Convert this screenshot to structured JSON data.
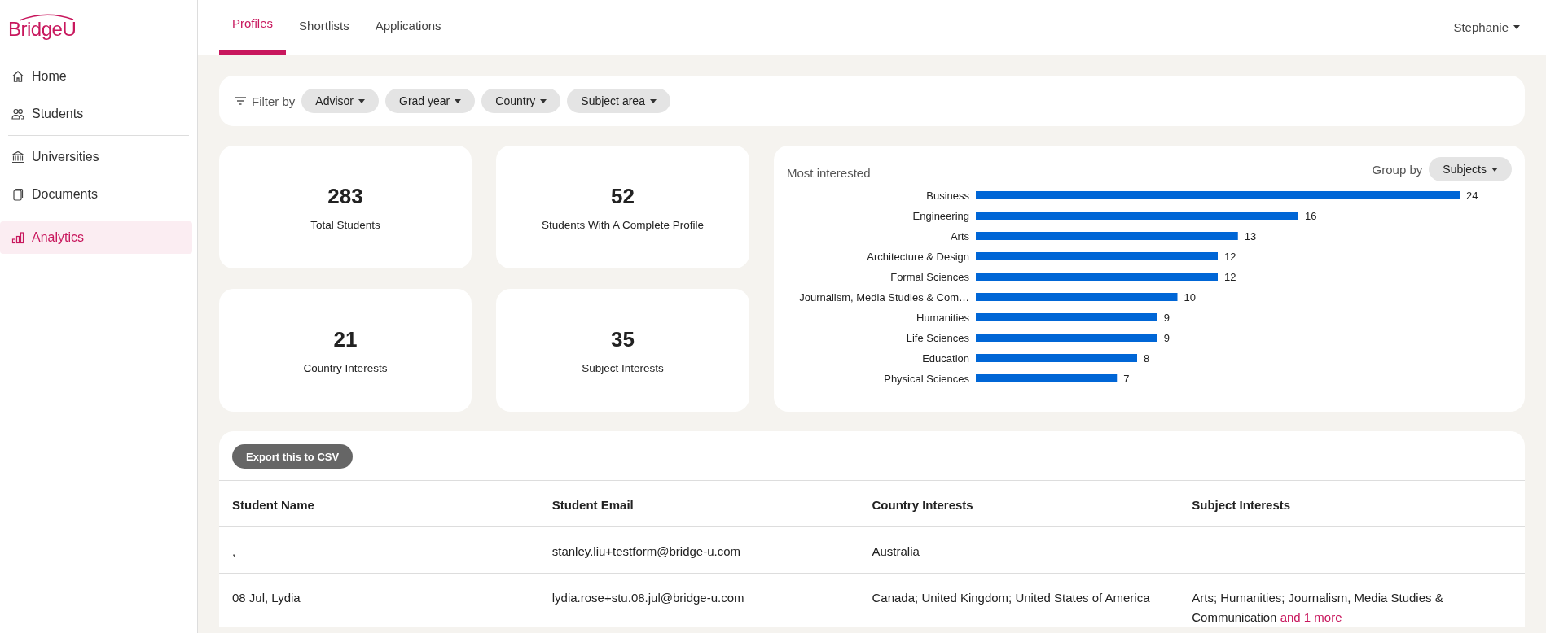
{
  "sidebar": {
    "logo": "BridgeU",
    "sections": [
      {
        "items": [
          {
            "label": "Home",
            "selected": false
          },
          {
            "label": "Students",
            "selected": false
          }
        ]
      },
      {
        "items": [
          {
            "label": "Universities",
            "selected": false
          },
          {
            "label": "Documents",
            "selected": false
          }
        ]
      },
      {
        "items": [
          {
            "label": "Analytics",
            "selected": true
          }
        ]
      }
    ]
  },
  "tabs": [
    {
      "label": "Profiles",
      "selected": true
    },
    {
      "label": "Shortlists",
      "selected": false
    },
    {
      "label": "Applications",
      "selected": false
    }
  ],
  "user_menu": "Stephanie",
  "filter_bar": {
    "label": "Filter by",
    "filters": [
      "Advisor",
      "Grad year",
      "Country",
      "Subject area"
    ]
  },
  "stats": [
    {
      "value": "283",
      "label": "Total Students"
    },
    {
      "value": "52",
      "label": "Students With A Complete Profile"
    },
    {
      "value": "21",
      "label": "Country Interests"
    },
    {
      "value": "35",
      "label": "Subject Interests"
    }
  ],
  "chart_panel": {
    "title": "Most interested",
    "group_by_label": "Group by",
    "group_by_value": "Subjects",
    "chart_data": {
      "type": "bar",
      "orientation": "horizontal",
      "data_labels": true,
      "categories": [
        "Business",
        "Engineering",
        "Arts",
        "Architecture & Design",
        "Formal Sciences",
        "Journalism, Media Studies & Com…",
        "Humanities",
        "Life Sciences",
        "Education",
        "Physical Sciences"
      ],
      "series": [
        {
          "color": "#0066d6",
          "values": [
            24,
            16,
            13,
            12,
            12,
            10,
            9,
            9,
            8,
            7
          ]
        }
      ]
    }
  },
  "table": {
    "export_button": "Export this to CSV",
    "columns": [
      "Student Name",
      "Student Email",
      "Country Interests",
      "Subject Interests"
    ],
    "rows": [
      {
        "name": ",",
        "email": "stanley.liu+testform@bridge-u.com",
        "countries": "Australia"
      },
      {
        "name": "08 Jul, Lydia",
        "email": "lydia.rose+stu.08.jul@bridge-u.com",
        "countries": "Canada; United Kingdom; United States of America",
        "subjects": "Arts; Humanities; Journalism, Media Studies & Communication",
        "subjects_more": "and 1 more"
      }
    ]
  }
}
